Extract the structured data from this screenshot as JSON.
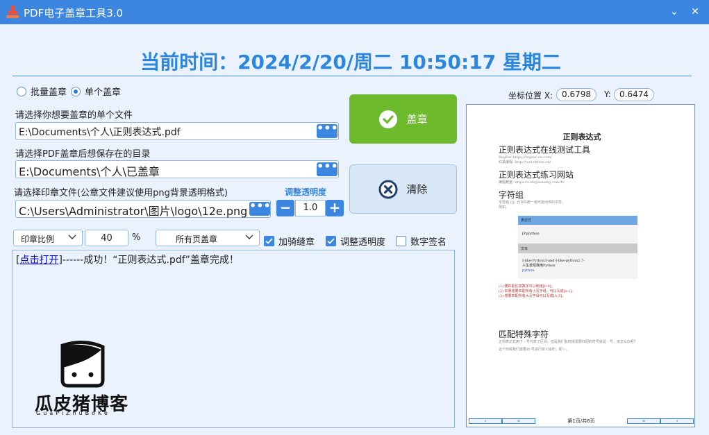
{
  "window": {
    "title": "PDF电子盖章工具3.0",
    "minimize_glyph": "⌄",
    "close_glyph": "✕"
  },
  "clock": "当前时间：2024/2/20/周二 10:50:17  星期二",
  "mode": {
    "batch_label": "批量盖章",
    "single_label": "单个盖章",
    "selected": "single"
  },
  "form": {
    "file_label": "请选择你想要盖章的单个文件",
    "file_value": "E:\\Documents\\个人\\正则表达式.pdf",
    "save_label": "请选择PDF盖章后想保存在的目录",
    "save_value": "E:\\Documents\\个人\\已盖章",
    "seal_label": "请选择印章文件(公章文件建议使用png背景透明格式)",
    "seal_value": "C:\\Users\\Administrator\\图片\\logo\\12e.png",
    "browse_glyph": "•••"
  },
  "buttons": {
    "stamp": "盖章",
    "clear": "清除"
  },
  "opacity": {
    "label": "调整透明度",
    "value": "1.0",
    "minus": "−",
    "plus": "+"
  },
  "options": {
    "ratio_label": "印章比例",
    "ratio_value": "40",
    "percent": "%",
    "pages_label": "所有页盖章",
    "checks": [
      {
        "label": "加骑缝章",
        "checked": true
      },
      {
        "label": "调整透明度",
        "checked": true
      },
      {
        "label": "数字签名",
        "checked": false
      }
    ]
  },
  "log": {
    "link": "点击打开",
    "prefix": "[",
    "suffix": "]------成功！“正则表达式.pdf”盖章完成！"
  },
  "logo": {
    "name": "瓜皮猪博客",
    "sub": "GuaPiZhuBoKe"
  },
  "coords": {
    "label": "坐标位置 X:",
    "x": "0.6798",
    "y_label": "Y:",
    "y": "0.6474"
  },
  "preview": {
    "title": "正则表达式",
    "h_test": "正则表达式在线测试工具",
    "s_test1": "RegExr:https://regexr-cn.com/",
    "s_test2": "红黑编程: http://tool.rbtree.cn/",
    "h_practice": "正则表达式练习网站",
    "s_practice": "编程教室: https://codejiaonang.com/#/",
    "h_group": "字符组",
    "s_group1": "字符组 ([]) 允许匹配一组可能出现的字符。",
    "s_group2": "例如:",
    "box_head": "表达式",
    "box_expr": "[Pp]ython",
    "box_head2": "文本",
    "box_text1": "I-like-Python3-and-I-like-python2.7-",
    "box_text2": "人生苦短我用Python",
    "box_text3": "python",
    "list1": "(1) 要匹配任意数字可以使用[0-9]。",
    "list2": "(2) 如果想要匹配所有小写字母，可以写成[a-z]。",
    "list3": "(3) 想要匹配所有大写字母可以写成[A-Z]。",
    "h_special": "匹配特殊字符",
    "s_special1": "正则表达式用了 - 号代表了区间，但是我们有时候需要匹配的符号就是 - 号，该怎么办呢？",
    "s_special2": "这个时候我们需要对-号进行转义操作，即 \\-。",
    "pager_text": "第1页/共6页",
    "prev": "‹",
    "first": "«",
    "next": "»",
    "last": "›"
  }
}
